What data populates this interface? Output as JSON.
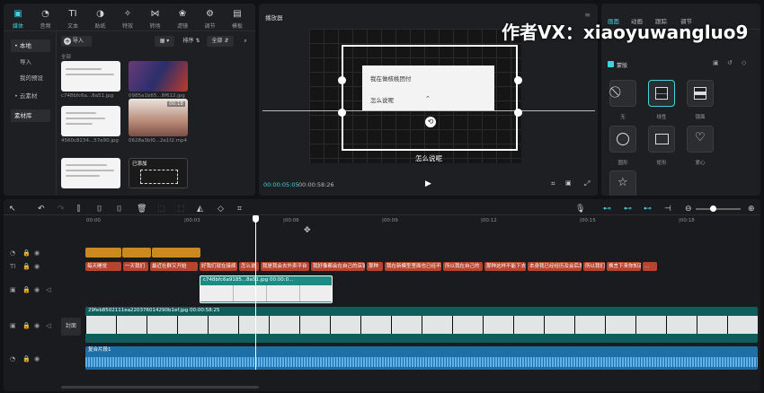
{
  "toolbar": {
    "items": [
      {
        "label": "媒体",
        "icon": "media-icon",
        "glyph": "▣"
      },
      {
        "label": "音频",
        "icon": "audio-icon",
        "glyph": "◔"
      },
      {
        "label": "文本",
        "icon": "text-icon",
        "glyph": "TI"
      },
      {
        "label": "贴纸",
        "icon": "sticker-icon",
        "glyph": "◑"
      },
      {
        "label": "特效",
        "icon": "effects-icon",
        "glyph": "✧"
      },
      {
        "label": "转场",
        "icon": "transition-icon",
        "glyph": "⋈"
      },
      {
        "label": "滤镜",
        "icon": "filter-icon",
        "glyph": "❀"
      },
      {
        "label": "调节",
        "icon": "adjust-icon",
        "glyph": "⚙"
      },
      {
        "label": "模板",
        "icon": "template-icon",
        "glyph": "▤"
      }
    ]
  },
  "sidebar": {
    "items": [
      {
        "label": "• 本地"
      },
      {
        "label": "导入"
      },
      {
        "label": "我的预设"
      },
      {
        "label": "• 云素材"
      },
      {
        "label": "素材库"
      }
    ]
  },
  "media": {
    "import_label": "导入",
    "sort_label": "排序",
    "all_label": "全部",
    "section_label": "全部",
    "items": [
      {
        "name": "c748bfc6a...8a51.jpg"
      },
      {
        "name": "0985a1b65...8f612.jpg"
      },
      {
        "name": "4560c8234...57e90.jpg"
      },
      {
        "name": "0628a3bf0...2e1f2.mp4",
        "duration": "00:18"
      },
      {
        "name": "",
        "badge": ""
      },
      {
        "name": "",
        "badge": "已添加"
      }
    ]
  },
  "player": {
    "title": "播放器",
    "bubble_line1": "我在做核桃团付",
    "bubble_line2": "怎么说呢",
    "caption": "怎么说呢",
    "time_current": "00:00:05:05",
    "time_total": "00:00:58:26"
  },
  "watermark": "作者VX：xiaoyuwangluo9",
  "right_panel": {
    "tabs": [
      "画面",
      "动画",
      "跟踪",
      "调节"
    ],
    "section": "蒙版",
    "masks": [
      "无",
      "线性",
      "镜面",
      "圆形",
      "矩形",
      "爱心",
      "星形"
    ]
  },
  "timeline": {
    "ticks": [
      "00:00",
      "|00:03",
      "|00:06",
      "|00:09",
      "|00:12",
      "|00:15",
      "|00:18"
    ],
    "cover_label": "封面",
    "video_clip_label": "c748bfc6a9185...8a51.jpg   00:00:0...",
    "main_clip_label": "29feb8502111ea220376014290b1ef.jpg   00:00:58:25",
    "audio_label": "复合片段1",
    "subtitles": [
      "每天睡觉",
      "一天我们",
      "最近社群又开始",
      "好我们就在接续",
      "怎么说",
      "我是我会去外卖平台",
      "我好像都会在自己的店铺是",
      "那种",
      "我在新模型里面也已经不需要",
      "所以我在自己的",
      "那种这样不能下去",
      "本身我已经经历及会后发布",
      "所以我们",
      "换言下来你知道",
      "..."
    ]
  }
}
